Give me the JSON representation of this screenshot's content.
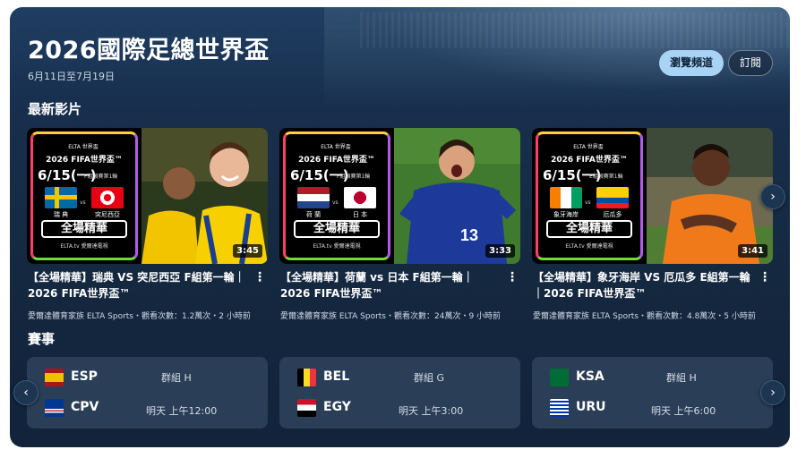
{
  "header": {
    "title": "2026國際足總世界盃",
    "dates": "6月11日至7月19日",
    "browse_label": "瀏覽頻道",
    "subscribe_label": "訂閱"
  },
  "sections": {
    "latest": "最新影片",
    "matches": "賽事"
  },
  "videos": [
    {
      "promo": {
        "logo": "ELTA 世界盃",
        "fifa": "2026 FIFA世界盃™",
        "date": "6/15(一)",
        "group": "F組預賽第1輪",
        "team_a": "瑞 典",
        "team_b": "突尼西亞",
        "highlight": "全場精華",
        "channel_tag": "ELTA.tv 愛爾達電視"
      },
      "duration": "3:45",
      "title": "【全場精華】瑞典 VS 突尼西亞 F組第一輪｜2026 FIFA世界盃™",
      "meta": "愛爾達體育家族 ELTA Sports・觀看次數：1.2萬次・2 小時前"
    },
    {
      "promo": {
        "logo": "ELTA 世界盃",
        "fifa": "2026 FIFA世界盃™",
        "date": "6/15(一)",
        "group": "F組預賽第1輪",
        "team_a": "荷 蘭",
        "team_b": "日 本",
        "highlight": "全場精華",
        "channel_tag": "ELTA.tv 愛爾達電視"
      },
      "duration": "3:33",
      "title": "【全場精華】荷蘭 vs 日本 F組第一輪｜2026 FIFA世界盃™",
      "meta": "愛爾達體育家族 ELTA Sports・觀看次數：24萬次・9 小時前"
    },
    {
      "promo": {
        "logo": "ELTA 世界盃",
        "fifa": "2026 FIFA世界盃™",
        "date": "6/15(一)",
        "group": "E組預賽第1輪",
        "team_a": "象牙海岸",
        "team_b": "厄瓜多",
        "highlight": "全場精華",
        "channel_tag": "ELTA.tv 愛爾達電視"
      },
      "duration": "3:41",
      "title": "【全場精華】象牙海岸 VS 厄瓜多 E組第一輪｜2026 FIFA世界盃™",
      "meta": "愛爾達體育家族 ELTA Sports・觀看次數：4.8萬次・5 小時前"
    }
  ],
  "matches": [
    {
      "team_a": "ESP",
      "team_b": "CPV",
      "group": "群組 H",
      "time": "明天 上午12:00"
    },
    {
      "team_a": "BEL",
      "team_b": "EGY",
      "group": "群組 G",
      "time": "明天 上午3:00"
    },
    {
      "team_a": "KSA",
      "team_b": "URU",
      "group": "群組 H",
      "time": "明天 上午6:00"
    }
  ],
  "icons": {
    "more": "⋮",
    "next": "›",
    "prev": "‹"
  },
  "colors": {
    "accent_button": "#a9d3f5",
    "card_bg": "#182f4d",
    "match_bg": "#2a3e57"
  }
}
